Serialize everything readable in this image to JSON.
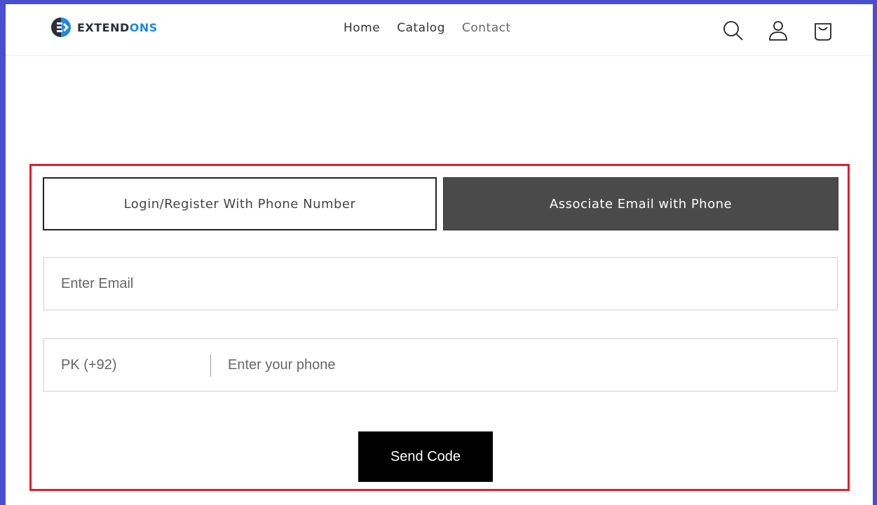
{
  "brand": {
    "name_part1": "EXTEND",
    "name_part2": "ONS",
    "accent_color": "#1e88e5",
    "logo_icon": "extendons-logo-icon"
  },
  "nav": {
    "items": [
      {
        "label": "Home"
      },
      {
        "label": "Catalog"
      },
      {
        "label": "Contact"
      }
    ]
  },
  "header_icons": [
    "search-icon",
    "account-icon",
    "cart-icon"
  ],
  "tabs": {
    "phone_label": "Login/Register With Phone Number",
    "email_label": "Associate Email with Phone",
    "active": "email"
  },
  "form": {
    "email_placeholder": "Enter Email",
    "country_code": "PK (+92)",
    "phone_placeholder": "Enter your phone",
    "send_label": "Send Code"
  },
  "colors": {
    "highlight_border": "#e0202b",
    "active_tab": "#4a4a4a",
    "button": "#000000"
  }
}
